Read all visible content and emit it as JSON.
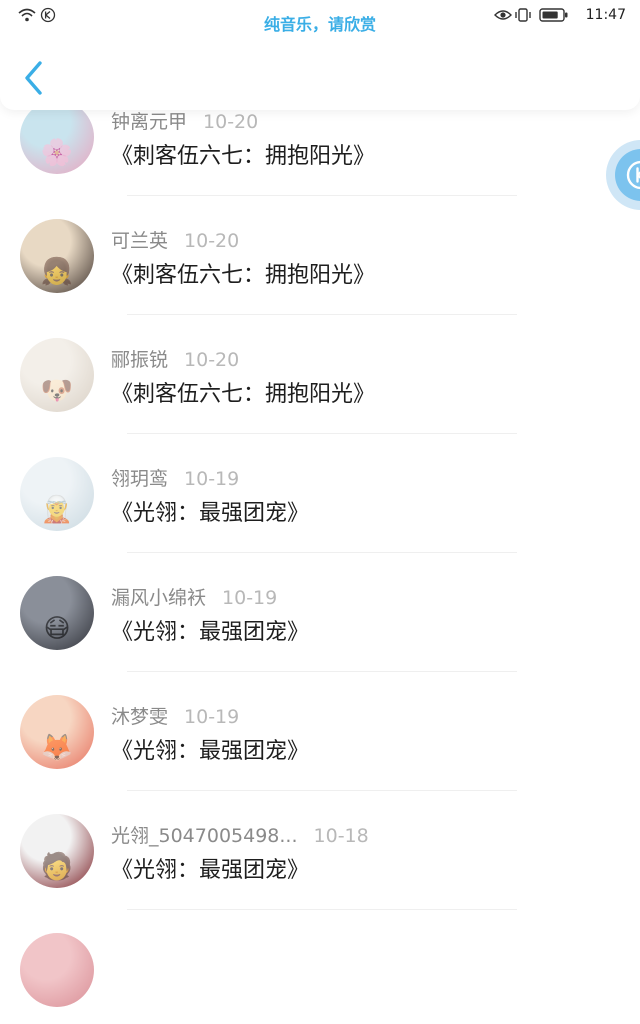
{
  "status_bar": {
    "time": "11:47",
    "left_icons": [
      "wifi-icon",
      "k-badge-icon"
    ],
    "right_icons": [
      "eye-icon",
      "vibrate-icon",
      "battery-icon"
    ],
    "battery_percent": 80
  },
  "header": {
    "title": "纯音乐，请欣赏",
    "back_icon": "chevron-left-icon",
    "accent_color": "#3aaee6"
  },
  "floating_widget": {
    "icon": "k-widget-icon"
  },
  "feed": {
    "items": [
      {
        "name": "",
        "date": "",
        "title": "《刺客伍六七：拥抱阳光》",
        "avatar_colors": [
          "#d8c9b8",
          "#6f5a4a"
        ],
        "avatar_glyph": ""
      },
      {
        "name": "钟离元甲",
        "date": "10-20",
        "title": "《刺客伍六七：拥抱阳光》",
        "avatar_colors": [
          "#c9e4ee",
          "#e9a3bd"
        ],
        "avatar_glyph": "🌸"
      },
      {
        "name": "可兰英",
        "date": "10-20",
        "title": "《刺客伍六七：拥抱阳光》",
        "avatar_colors": [
          "#e8d9c4",
          "#3b2f2a"
        ],
        "avatar_glyph": "👧"
      },
      {
        "name": "郦振锐",
        "date": "10-20",
        "title": "《刺客伍六七：拥抱阳光》",
        "avatar_colors": [
          "#f3efe9",
          "#d9d0c5"
        ],
        "avatar_glyph": "🐶"
      },
      {
        "name": "翎玥鸾",
        "date": "10-19",
        "title": "《光翎：最强团宠》",
        "avatar_colors": [
          "#eef3f6",
          "#c9d8e0"
        ],
        "avatar_glyph": "🧝"
      },
      {
        "name": "漏风小绵袄",
        "date": "10-19",
        "title": "《光翎：最强团宠》",
        "avatar_colors": [
          "#8a8f99",
          "#2f3138"
        ],
        "avatar_glyph": "😷"
      },
      {
        "name": "沐梦雯",
        "date": "10-19",
        "title": "《光翎：最强团宠》",
        "avatar_colors": [
          "#f7d6c2",
          "#e66f5c"
        ],
        "avatar_glyph": "🦊"
      },
      {
        "name": "光翎_5047005498...",
        "date": "10-18",
        "title": "《光翎：最强团宠》",
        "avatar_colors": [
          "#f2f2f2",
          "#7a1f25"
        ],
        "avatar_glyph": "🧑"
      },
      {
        "name": "",
        "date": "",
        "title": "",
        "avatar_colors": [
          "#f1c5c8",
          "#d98e96"
        ],
        "avatar_glyph": ""
      }
    ]
  }
}
